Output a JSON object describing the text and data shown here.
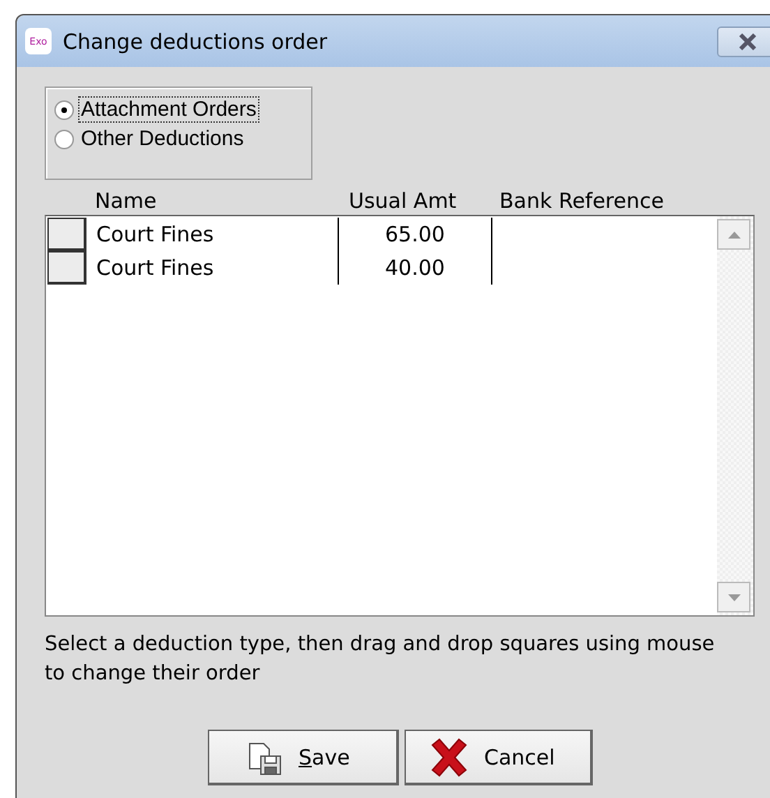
{
  "window": {
    "title": "Change deductions order",
    "app_icon_text": "Exo"
  },
  "deduction_types": [
    {
      "label": "Attachment Orders",
      "selected": true
    },
    {
      "label": "Other Deductions",
      "selected": false
    }
  ],
  "table": {
    "columns": [
      "Name",
      "Usual Amt",
      "Bank Reference"
    ],
    "rows": [
      {
        "name": "Court Fines",
        "usual_amt": "65.00"
      },
      {
        "name": "Court Fines",
        "usual_amt": "40.00"
      }
    ]
  },
  "hint": "Select a deduction type, then drag and drop squares using mouse to change their order",
  "buttons": [
    {
      "kind": "save",
      "access_key": "S",
      "label_rest": "ave"
    },
    {
      "kind": "cancel",
      "label": "Cancel"
    }
  ]
}
